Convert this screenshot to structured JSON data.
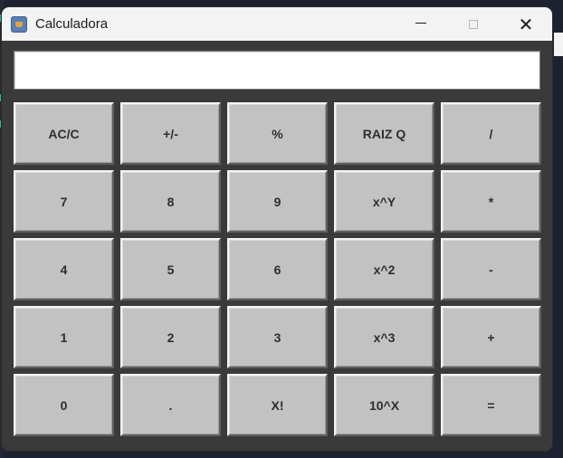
{
  "window": {
    "title": "Calculadora",
    "icon": "java-coffee-cup-icon",
    "controls": {
      "minimize": "—",
      "maximize": "☐",
      "close": "✕"
    }
  },
  "display": {
    "value": ""
  },
  "keys": [
    [
      "AC/C",
      "+/-",
      "%",
      "RAIZ Q",
      "/"
    ],
    [
      "7",
      "8",
      "9",
      "x^Y",
      "*"
    ],
    [
      "4",
      "5",
      "6",
      "x^2",
      "-"
    ],
    [
      "1",
      "2",
      "3",
      "x^3",
      "+"
    ],
    [
      "0",
      ".",
      "X!",
      "10^X",
      "="
    ]
  ],
  "colors": {
    "window_background": "#3a3a3a",
    "titlebar": "#f3f3f3",
    "button_face": "#c2c2c2",
    "display_background": "#ffffff"
  }
}
